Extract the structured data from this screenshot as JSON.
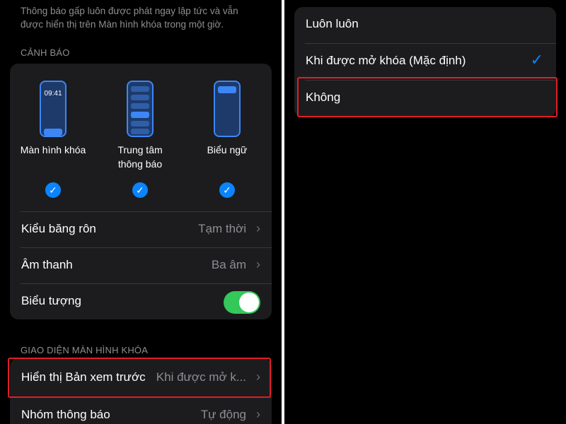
{
  "left": {
    "description": "Thông báo gấp luôn được phát ngay lập tức và vẫn được hiển thị trên Màn hình khóa trong một giờ.",
    "alerts_header": "CẢNH BÁO",
    "alert_styles": [
      {
        "label": "Màn hình khóa",
        "checked": true,
        "lock_time": "09:41"
      },
      {
        "label": "Trung tâm\nthông báo",
        "checked": true
      },
      {
        "label": "Biểu ngữ",
        "checked": true
      }
    ],
    "rows": {
      "banner_style": {
        "label": "Kiểu băng rôn",
        "value": "Tạm thời"
      },
      "sounds": {
        "label": "Âm thanh",
        "value": "Ba âm"
      },
      "badges": {
        "label": "Biểu tượng",
        "toggle_on": true
      }
    },
    "lock_screen_header": "GIAO DIỆN MÀN HÌNH KHÓA",
    "show_previews": {
      "label": "Hiển thị Bản xem trước",
      "value": "Khi được mở k..."
    },
    "grouping": {
      "label": "Nhóm thông báo",
      "value": "Tự động"
    }
  },
  "right": {
    "options": [
      {
        "label": "Luôn luôn",
        "selected": false
      },
      {
        "label": "Khi được mở khóa (Mặc định)",
        "selected": true
      },
      {
        "label": "Không",
        "selected": false
      }
    ]
  },
  "colors": {
    "accent": "#0a84ff",
    "highlight": "#e01e25",
    "toggle_on": "#34c759",
    "card": "#1c1c1e"
  }
}
